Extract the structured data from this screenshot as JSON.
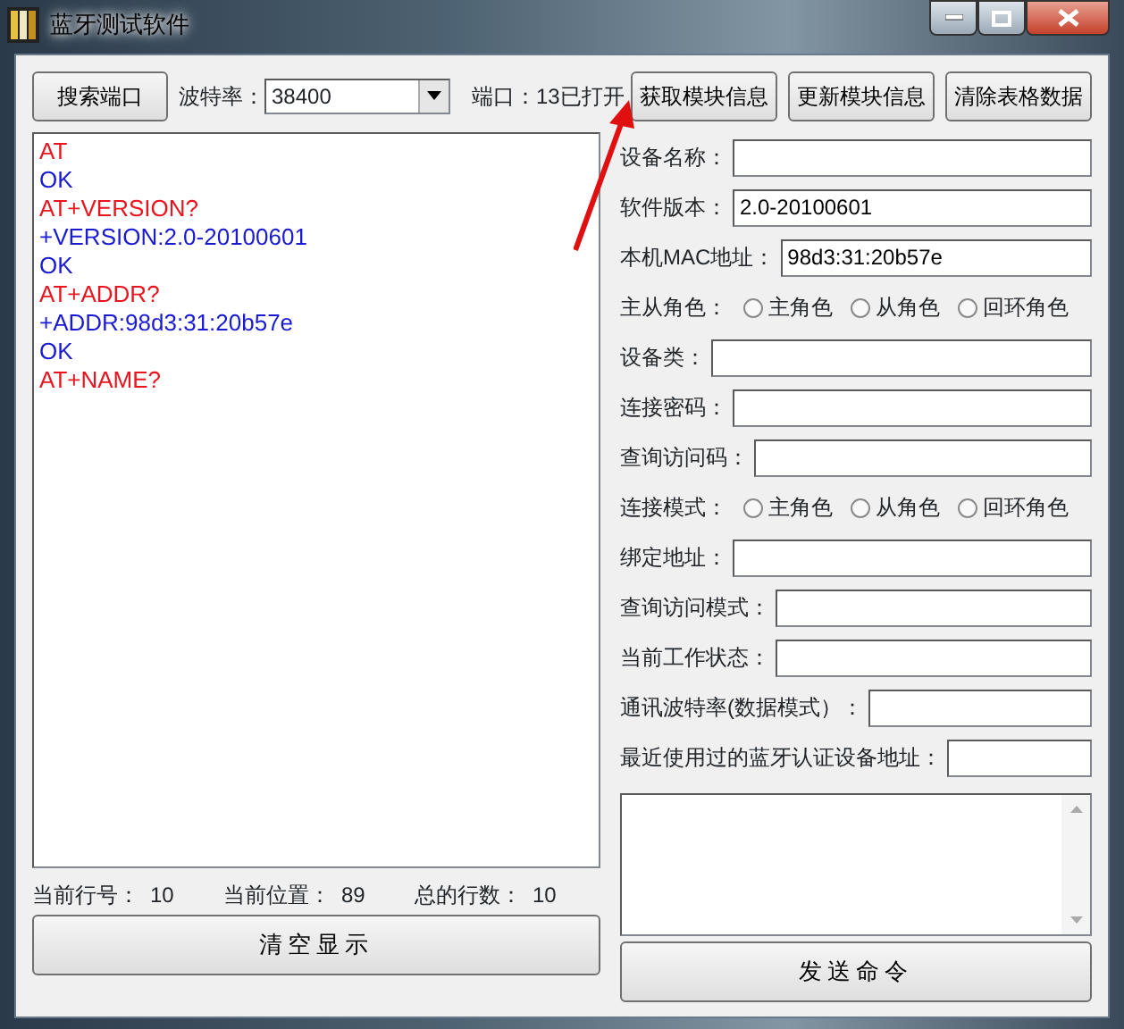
{
  "window": {
    "title": "蓝牙测试软件"
  },
  "toolbar": {
    "search_button": "搜索端口",
    "baud_label": "波特率：",
    "baud_value": "38400",
    "port_status": "端口：13已打开",
    "buttons": [
      "获取模块信息",
      "更新模块信息",
      "清除表格数据"
    ]
  },
  "log": [
    {
      "kind": "sent",
      "text": "AT"
    },
    {
      "kind": "received",
      "text": "OK"
    },
    {
      "kind": "sent",
      "text": "AT+VERSION?"
    },
    {
      "kind": "received",
      "text": "+VERSION:2.0-20100601"
    },
    {
      "kind": "received",
      "text": "OK"
    },
    {
      "kind": "sent",
      "text": "AT+ADDR?"
    },
    {
      "kind": "received",
      "text": "+ADDR:98d3:31:20b57e"
    },
    {
      "kind": "received",
      "text": "OK"
    },
    {
      "kind": "sent",
      "text": "AT+NAME?"
    }
  ],
  "status": [
    {
      "label": "当前行号：",
      "value": "10"
    },
    {
      "label": "当前位置：",
      "value": "89"
    },
    {
      "label": "总的行数：",
      "value": "10"
    }
  ],
  "clear_button": "清空显示",
  "fields": [
    {
      "kind": "field",
      "label": "设备名称："
    },
    {
      "kind": "field",
      "label": "软件版本：",
      "value": "2.0-20100601"
    },
    {
      "kind": "field",
      "label": "本机MAC地址：",
      "value": "98d3:31:20b57e"
    },
    {
      "kind": "radio",
      "label": "主从角色：",
      "options": [
        {
          "label": "主角色",
          "selected": false
        },
        {
          "label": "从角色",
          "selected": false
        },
        {
          "label": "回环角色",
          "selected": false
        }
      ]
    },
    {
      "kind": "field",
      "label": "设备类："
    },
    {
      "kind": "field",
      "label": "连接密码："
    },
    {
      "kind": "field",
      "label": "查询访问码："
    },
    {
      "kind": "radio",
      "label": "连接模式：",
      "options": [
        {
          "label": "主角色",
          "selected": false
        },
        {
          "label": "从角色",
          "selected": false
        },
        {
          "label": "回环角色",
          "selected": false
        }
      ]
    },
    {
      "kind": "field",
      "label": "绑定地址："
    },
    {
      "kind": "field",
      "label": "查询访问模式："
    },
    {
      "kind": "field",
      "label": "当前工作状态："
    },
    {
      "kind": "field",
      "label": "通讯波特率(数据模式）："
    },
    {
      "kind": "field",
      "label": "最近使用过的蓝牙认证设备地址："
    }
  ],
  "send_button": "发送命令"
}
